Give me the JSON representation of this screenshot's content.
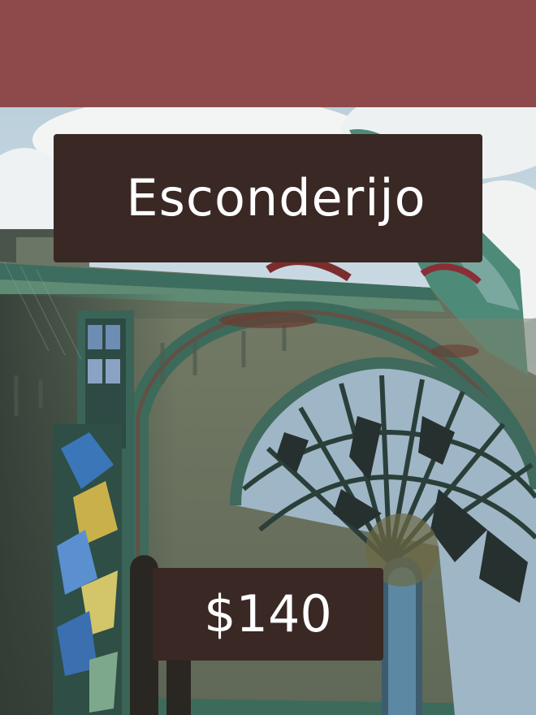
{
  "header": {
    "bar_color": "#8e4a4a"
  },
  "card": {
    "title": "Esconderijo",
    "price": "$140",
    "label_bg_color": "#3a2825",
    "label_text_color": "#ffffff"
  },
  "image": {
    "semantic": "illustration-abandoned-stained-glass-building"
  }
}
